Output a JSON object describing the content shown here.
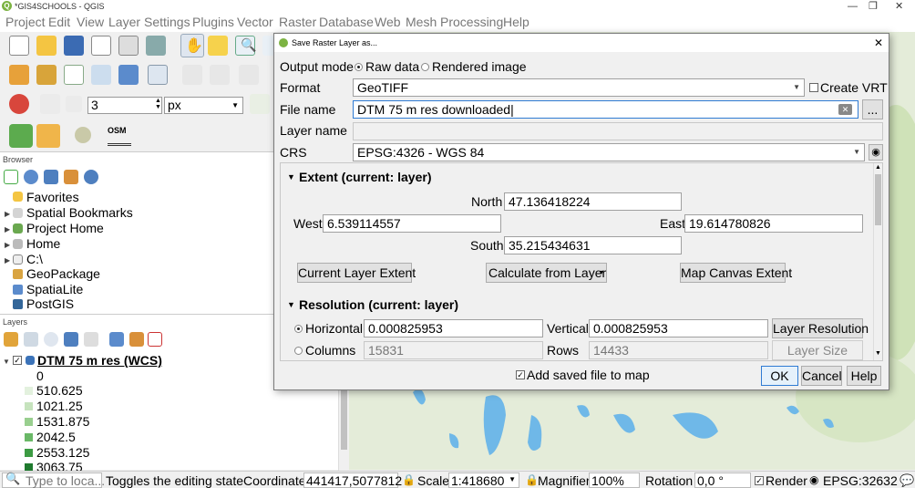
{
  "window": {
    "title": "*GIS4SCHOOLS - QGIS",
    "app_logo": "Q"
  },
  "menu": [
    "Project",
    "Edit",
    "View",
    "Layer",
    "Settings",
    "Plugins",
    "Vector",
    "Raster",
    "Database",
    "Web",
    "Mesh",
    "Processing",
    "Help"
  ],
  "toolbar": {
    "snap_tolerance": "3",
    "snap_unit": "px",
    "osm_label": "OSM"
  },
  "browser": {
    "title": "Browser",
    "items": [
      "Favorites",
      "Spatial Bookmarks",
      "Project Home",
      "Home",
      "C:\\",
      "GeoPackage",
      "SpatiaLite",
      "PostGIS"
    ]
  },
  "layers": {
    "title": "Layers",
    "layer_name": "DTM 75 m res (WCS)",
    "legend": [
      {
        "label": "0",
        "color": "#ffffff"
      },
      {
        "label": "510.625",
        "color": "#e3f1de"
      },
      {
        "label": "1021.25",
        "color": "#c6e3bd"
      },
      {
        "label": "1531.875",
        "color": "#99cf8f"
      },
      {
        "label": "2042.5",
        "color": "#6ab867"
      },
      {
        "label": "2553.125",
        "color": "#3c9b43"
      },
      {
        "label": "3063.75",
        "color": "#1f7a2e"
      }
    ]
  },
  "status": {
    "search_placeholder": "Type to loca...",
    "message": "Toggles the editing state",
    "coordinate_label": "Coordinate",
    "coordinate_value": "441417,5077812",
    "scale_label": "Scale",
    "scale_value": "1:418680",
    "magnifier_label": "Magnifier",
    "magnifier_value": "100%",
    "rotation_label": "Rotation",
    "rotation_value": "0,0 °",
    "render_label": "Render",
    "crs": "EPSG:32632"
  },
  "dialog": {
    "title": "Save Raster Layer as...",
    "output_mode_label": "Output mode",
    "raw_data_label": "Raw data",
    "rendered_image_label": "Rendered image",
    "format_label": "Format",
    "format_value": "GeoTIFF",
    "create_vrt_label": "Create VRT",
    "file_name_label": "File name",
    "file_name_value": "DTM 75 m res downloaded",
    "browse_label": "...",
    "layer_name_label": "Layer name",
    "layer_name_value": "",
    "crs_label": "CRS",
    "crs_value": "EPSG:4326 - WGS 84",
    "extent": {
      "header": "Extent (current: layer)",
      "north_label": "North",
      "north_value": "47.136418224",
      "west_label": "West",
      "west_value": "6.539114557",
      "east_label": "East",
      "east_value": "19.614780826",
      "south_label": "South",
      "south_value": "35.215434631",
      "current_layer_btn": "Current Layer Extent",
      "calc_from_layer_btn": "Calculate from Layer",
      "map_canvas_btn": "Map Canvas Extent"
    },
    "resolution": {
      "header": "Resolution (current: layer)",
      "horizontal_label": "Horizontal",
      "horizontal_value": "0.000825953",
      "vertical_label": "Vertical",
      "vertical_value": "0.000825953",
      "layer_resolution_btn": "Layer Resolution",
      "columns_label": "Columns",
      "columns_value": "15831",
      "rows_label": "Rows",
      "rows_value": "14433",
      "layer_size_btn": "Layer Size"
    },
    "add_to_map_label": "Add saved file to map",
    "ok_label": "OK",
    "cancel_label": "Cancel",
    "help_label": "Help"
  }
}
